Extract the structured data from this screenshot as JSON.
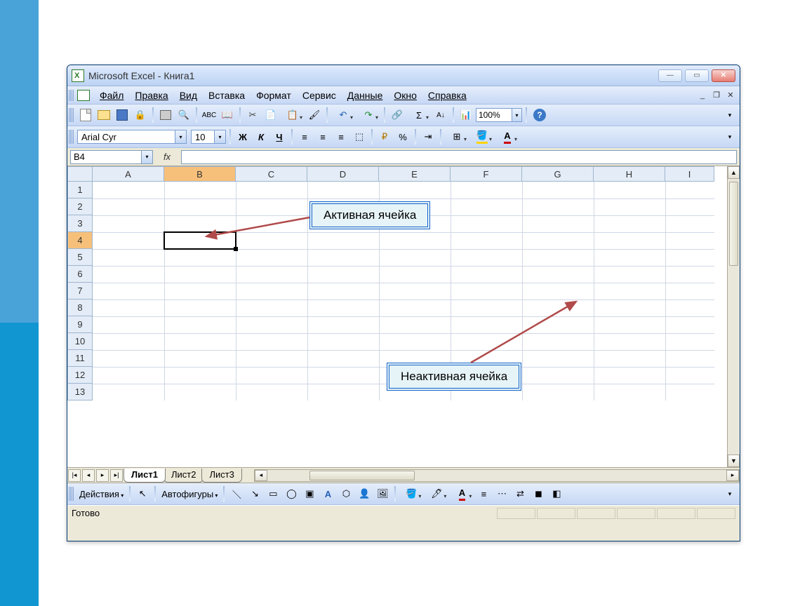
{
  "title": "Microsoft Excel - Книга1",
  "menu": {
    "file": "Файл",
    "edit": "Правка",
    "view": "Вид",
    "insert": "Вставка",
    "format": "Формат",
    "tools": "Сервис",
    "data": "Данные",
    "window": "Окно",
    "help": "Справка"
  },
  "toolbar": {
    "zoom": "100%"
  },
  "formatting": {
    "font_name": "Arial Cyr",
    "font_size": "10",
    "bold": "Ж",
    "italic": "К",
    "underline": "Ч",
    "percent": "%"
  },
  "formula_bar": {
    "name_box": "B4",
    "fx_label": "fx",
    "formula": ""
  },
  "grid": {
    "columns": [
      "A",
      "B",
      "C",
      "D",
      "E",
      "F",
      "G",
      "H",
      "I"
    ],
    "rows": [
      "1",
      "2",
      "3",
      "4",
      "5",
      "6",
      "7",
      "8",
      "9",
      "10",
      "11",
      "12",
      "13"
    ],
    "selected_column": "B",
    "selected_row": "4"
  },
  "sheets": {
    "active": "Лист1",
    "tabs": [
      "Лист1",
      "Лист2",
      "Лист3"
    ]
  },
  "drawing": {
    "actions": "Действия",
    "autoshapes": "Автофигуры"
  },
  "status": {
    "ready": "Готово"
  },
  "annotations": {
    "active_cell": "Активная ячейка",
    "inactive_cell": "Неактивная ячейка"
  }
}
